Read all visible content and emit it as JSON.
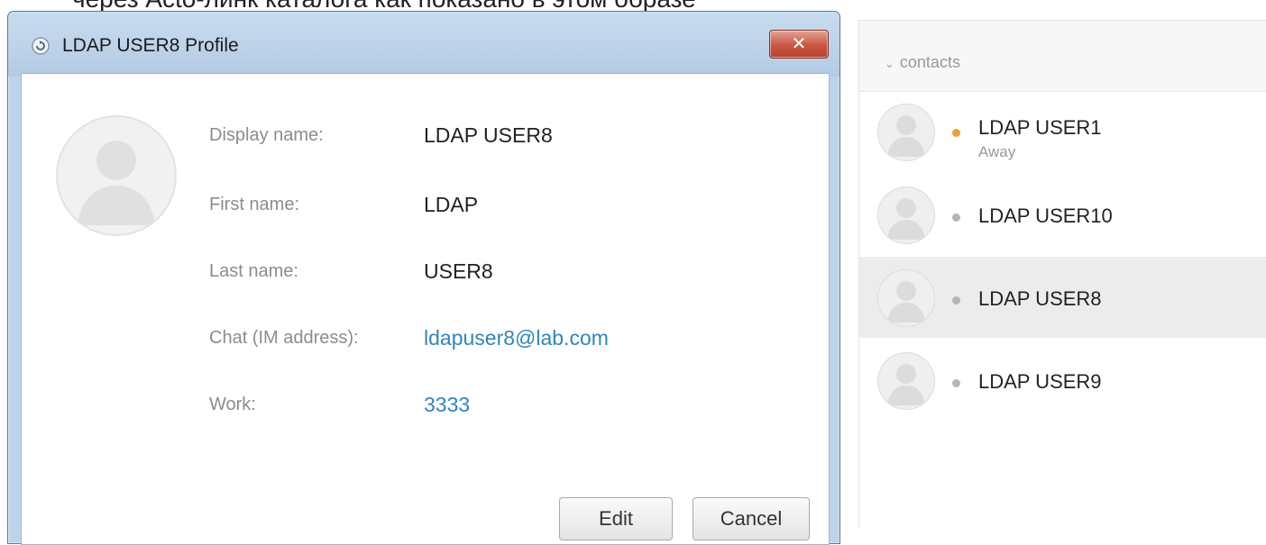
{
  "caption": "через Acto-линк каталога как показано в этом образе",
  "window": {
    "title": "LDAP USER8 Profile",
    "close_label": "✕"
  },
  "profile": {
    "fields": [
      {
        "label": "Display name:",
        "value": "LDAP USER8"
      },
      {
        "label": "First name:",
        "value": "LDAP"
      },
      {
        "label": "Last name:",
        "value": "USER8"
      },
      {
        "label": "Chat (IM address):",
        "value": "ldapuser8@lab.com"
      },
      {
        "label": "Work:",
        "value": "3333"
      }
    ],
    "edit_label": "Edit",
    "cancel_label": "Cancel"
  },
  "contacts": {
    "group_label": "contacts",
    "items": [
      {
        "name": "LDAP USER1",
        "status": "Away",
        "presence_color": "#f0a030"
      },
      {
        "name": "LDAP USER10",
        "status": "",
        "presence_color": "#b5b5b5"
      },
      {
        "name": "LDAP USER8",
        "status": "",
        "presence_color": "#b5b5b5",
        "selected": true
      },
      {
        "name": "LDAP USER9",
        "status": "",
        "presence_color": "#b5b5b5"
      }
    ]
  },
  "colors": {
    "link": "#2e86c0",
    "titlebar": "#bcd3ea",
    "close": "#c8563f"
  }
}
